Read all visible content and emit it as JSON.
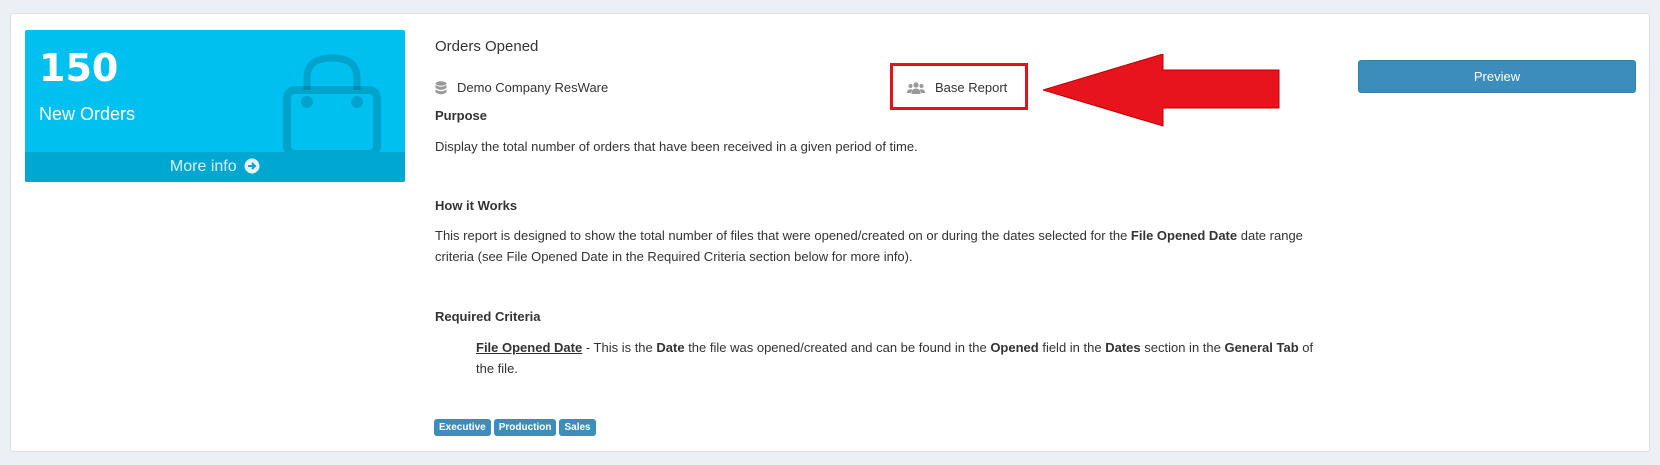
{
  "widget": {
    "count": "150",
    "label": "New Orders",
    "more_info": "More info",
    "icon": "shopping-bag-icon"
  },
  "report": {
    "title": "Orders Opened",
    "company": "Demo Company ResWare",
    "base_report": "Base Report",
    "preview_label": "Preview"
  },
  "sections": {
    "purpose_heading": "Purpose",
    "purpose_text": "Display the total number of orders that have been received in a given period of time.",
    "how_heading": "How it Works",
    "how_text_1": "This report is designed to show the total number of files that were opened/created on or during the dates selected for the ",
    "how_text_bold": "File Opened Date",
    "how_text_2": " date range criteria (see File Opened Date in the Required Criteria section below for more info).",
    "required_heading": "Required Criteria",
    "criteria": {
      "field": "File Opened Date",
      "t1": " - This is the ",
      "b1": "Date",
      "t2": " the file was opened/created and can be found in the ",
      "b2": "Opened",
      "t3": " field in the ",
      "b3": "Dates",
      "t4": " section in the ",
      "b4": "General Tab",
      "t5": " of the file."
    }
  },
  "tags": [
    "Executive",
    "Production",
    "Sales"
  ],
  "colors": {
    "widget_bg": "#00c0ef",
    "widget_footer": "#00a7d0",
    "primary": "#3c8dbc",
    "annotation_red": "#e0141e"
  }
}
